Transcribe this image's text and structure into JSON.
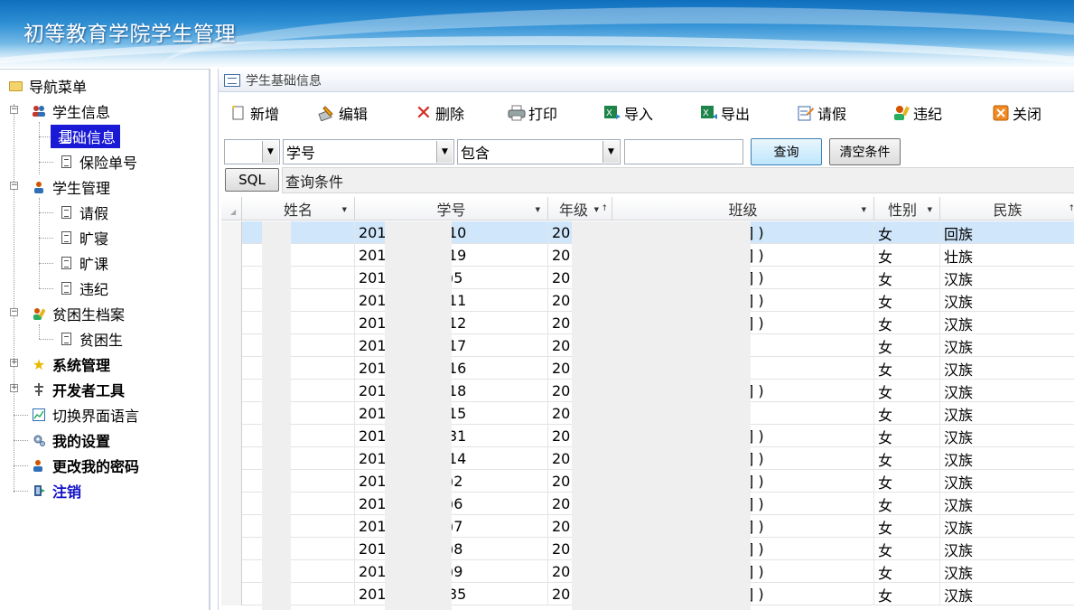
{
  "app": {
    "title": "初等教育学院学生管理"
  },
  "nav": {
    "root_label": "导航菜单",
    "groups": [
      {
        "label": "学生信息",
        "children": [
          "基础信息",
          "保险单号"
        ]
      },
      {
        "label": "学生管理",
        "children": [
          "请假",
          "旷寝",
          "旷课",
          "违纪"
        ]
      },
      {
        "label": "贫困生档案",
        "children": [
          "贫困生"
        ]
      }
    ],
    "system": "系统管理",
    "devtools": "开发者工具",
    "language": "切换界面语言",
    "settings": "我的设置",
    "password": "更改我的密码",
    "logout": "注销",
    "selected": "基础信息"
  },
  "panel": {
    "title": "学生基础信息"
  },
  "toolbar": {
    "add": "新增",
    "edit": "编辑",
    "delete": "删除",
    "print": "打印",
    "import": "导入",
    "export": "导出",
    "leave": "请假",
    "discipline": "违纪",
    "close": "关闭"
  },
  "filter": {
    "field_value": "学号",
    "operator_value": "包含",
    "query_button": "查询",
    "clear_button": "清空条件",
    "sql_button": "SQL",
    "sql_placeholder": "查询条件"
  },
  "grid": {
    "columns": [
      "姓名",
      "学号",
      "年级",
      "班级",
      "性别",
      "民族"
    ],
    "rows": [
      {
        "id_prefix": "201",
        "id_suffix": "10",
        "grade": "20",
        "class_tail": "] )",
        "gender": "女",
        "ethnicity": "回族"
      },
      {
        "id_prefix": "201",
        "id_suffix": "19",
        "grade": "20",
        "class_tail": "] )",
        "gender": "女",
        "ethnicity": "壮族"
      },
      {
        "id_prefix": "201",
        "id_suffix": ")5",
        "grade": "20",
        "class_tail": "] )",
        "gender": "女",
        "ethnicity": "汉族"
      },
      {
        "id_prefix": "201",
        "id_suffix": "11",
        "grade": "20",
        "class_tail": "] )",
        "gender": "女",
        "ethnicity": "汉族"
      },
      {
        "id_prefix": "201",
        "id_suffix": "12",
        "grade": "20",
        "class_tail": "] )",
        "gender": "女",
        "ethnicity": "汉族"
      },
      {
        "id_prefix": "201",
        "id_suffix": "17",
        "grade": "20",
        "class_tail": "",
        "gender": "女",
        "ethnicity": "汉族"
      },
      {
        "id_prefix": "201",
        "id_suffix": "16",
        "grade": "20",
        "class_tail": "",
        "gender": "女",
        "ethnicity": "汉族"
      },
      {
        "id_prefix": "201",
        "id_suffix": "18",
        "grade": "20",
        "class_tail": "] )",
        "gender": "女",
        "ethnicity": "汉族"
      },
      {
        "id_prefix": "201",
        "id_suffix": "15",
        "grade": "20",
        "class_tail": "",
        "gender": "女",
        "ethnicity": "汉族"
      },
      {
        "id_prefix": "201",
        "id_suffix": "31",
        "grade": "20",
        "class_tail": "] )",
        "gender": "女",
        "ethnicity": "汉族"
      },
      {
        "id_prefix": "201",
        "id_suffix": "14",
        "grade": "20",
        "class_tail": "] )",
        "gender": "女",
        "ethnicity": "汉族"
      },
      {
        "id_prefix": "201",
        "id_suffix": ")2",
        "grade": "20",
        "class_tail": "] )",
        "gender": "女",
        "ethnicity": "汉族"
      },
      {
        "id_prefix": "201",
        "id_suffix": ")6",
        "grade": "20",
        "class_tail": "] )",
        "gender": "女",
        "ethnicity": "汉族"
      },
      {
        "id_prefix": "201",
        "id_suffix": ")7",
        "grade": "20",
        "class_tail": "] )",
        "gender": "女",
        "ethnicity": "汉族"
      },
      {
        "id_prefix": "201",
        "id_suffix": ")8",
        "grade": "20",
        "class_tail": "] )",
        "gender": "女",
        "ethnicity": "汉族"
      },
      {
        "id_prefix": "201",
        "id_suffix": ")9",
        "grade": "20",
        "class_tail": "] )",
        "gender": "女",
        "ethnicity": "汉族"
      },
      {
        "id_prefix": "201",
        "id_suffix": "35",
        "grade": "20",
        "class_tail": "] )",
        "gender": "女",
        "ethnicity": "汉族"
      }
    ]
  }
}
